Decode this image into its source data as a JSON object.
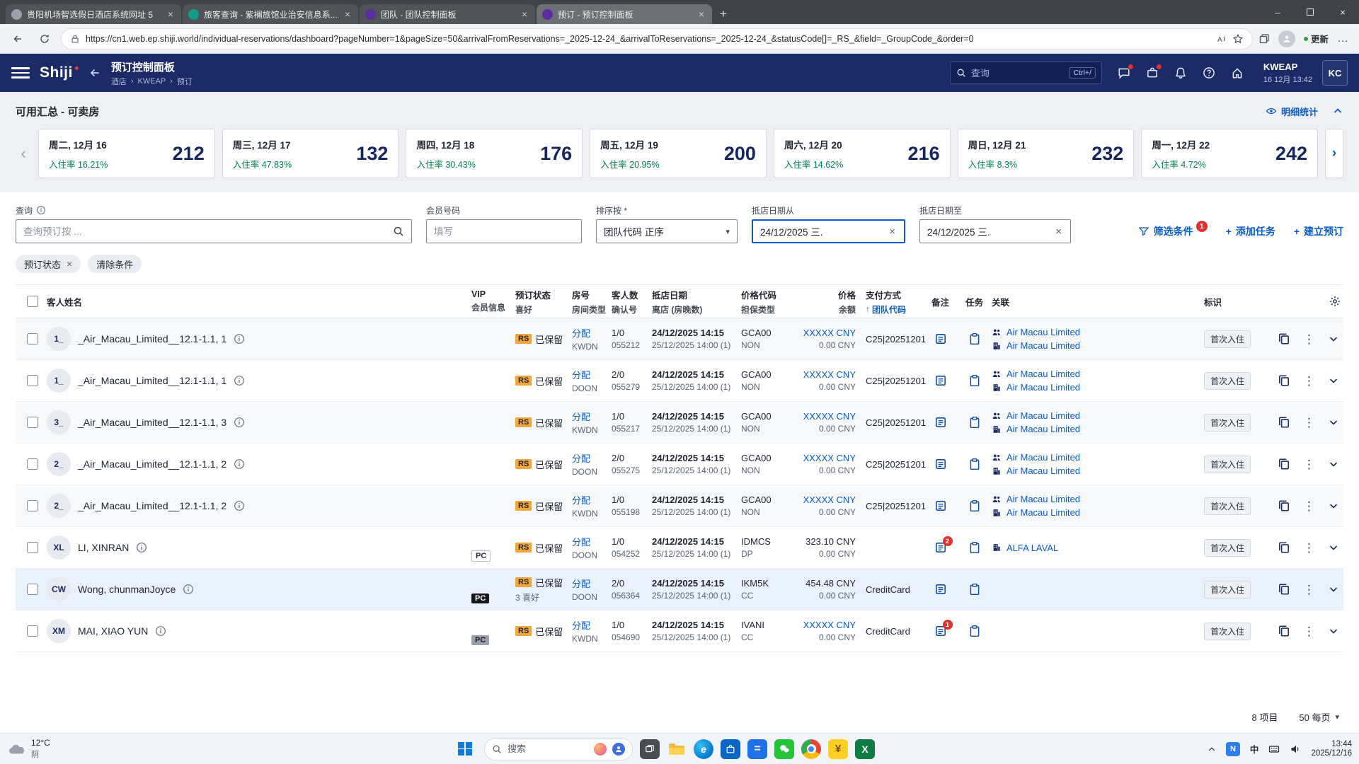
{
  "icons": {
    "close": "×",
    "plus": "+",
    "kebab": "⋮",
    "arrow_left": "‹",
    "arrow_right": "›",
    "sort_up": "↑",
    "caret_down": "▾",
    "ellipsis": "…",
    "breadcrumb_sep": "›",
    "minimize": "–"
  },
  "browser": {
    "tabs": [
      {
        "title": "贵阳机场智选假日酒店系统网址 5",
        "fav": "fav-gray",
        "cls": ""
      },
      {
        "title": "旅客查询 - 紫襕旅馆业治安信息系...",
        "fav": "fav-teal",
        "cls": ""
      },
      {
        "title": "团队 - 团队控制面板",
        "fav": "fav-purple",
        "cls": ""
      },
      {
        "title": "预订 - 预订控制面板",
        "fav": "fav-purple",
        "cls": "active"
      }
    ],
    "url": "https://cn1.web.ep.shiji.world/individual-reservations/dashboard?pageNumber=1&pageSize=50&arrivalFromReservations=_2025-12-24_&arrivalToReservations=_2025-12-24_&statusCode[]=_RS_&field=_GroupCode_&order=0",
    "update_label": "更新"
  },
  "app_header": {
    "logo": "Shiji",
    "title": "预订控制面板",
    "breadcrumb": {
      "hotel": "酒店",
      "property": "KWEAP",
      "page": "预订"
    },
    "search_placeholder": "查询",
    "search_shortcut": "Ctrl+/",
    "property": "KWEAP",
    "datetime": "16 12月 13:42",
    "avatar": "KC"
  },
  "availability": {
    "title": "可用汇总 - 可卖房",
    "detail_link": "明细统计",
    "days": [
      {
        "date": "周二, 12月 16",
        "occ": "入住率 16.21%",
        "count": "212"
      },
      {
        "date": "周三, 12月 17",
        "occ": "入住率 47.83%",
        "count": "132"
      },
      {
        "date": "周四, 12月 18",
        "occ": "入住率 30.43%",
        "count": "176"
      },
      {
        "date": "周五, 12月 19",
        "occ": "入住率 20.95%",
        "count": "200"
      },
      {
        "date": "周六, 12月 20",
        "occ": "入住率 14.62%",
        "count": "216"
      },
      {
        "date": "周日, 12月 21",
        "occ": "入住率 8.3%",
        "count": "232"
      },
      {
        "date": "周一, 12月 22",
        "occ": "入住率 4.72%",
        "count": "242"
      }
    ]
  },
  "filters": {
    "query_label": "查询",
    "query_placeholder": "查询预订按 ...",
    "member_label": "会员号码",
    "member_placeholder": "填写",
    "sort_label": "排序按 *",
    "sort_value": "团队代码 正序",
    "arrival_from_label": "抵店日期从",
    "arrival_from_value": "24/12/2025 三.",
    "arrival_to_label": "抵店日期至",
    "arrival_to_value": "24/12/2025 三.",
    "filter_button": "筛选条件",
    "filter_badge": "1",
    "add_task_button": "添加任务",
    "create_reservation_button": "建立预订",
    "chip_status": "预订状态",
    "chip_clear": "清除条件"
  },
  "table": {
    "headers": {
      "guest": "客人姓名",
      "vip1": "VIP",
      "vip2": "会员信息",
      "status1": "预订状态",
      "status2": "喜好",
      "room1": "房号",
      "room2": "房间类型",
      "guests1": "客人数",
      "guests2": "确认号",
      "dates1": "抵店日期",
      "dates2": "离店 (房晚数)",
      "rate1": "价格代码",
      "rate2": "担保类型",
      "price1": "价格",
      "price2": "余额",
      "pay1": "支付方式",
      "pay2": "团队代码",
      "notes": "备注",
      "tasks": "任务",
      "links": "关联",
      "tags": "标识"
    },
    "rows": [
      {
        "initials": "1_",
        "name": "_Air_Macau_Limited__12.1-1.1, 1",
        "vip": "",
        "vip_cls": "",
        "status_code": "RS",
        "status": "已保留",
        "prefs": "",
        "room_action": "分配",
        "room_type": "KWDN",
        "guests": "1/0",
        "confirmation": "055212",
        "arrival": "24/12/2025 14:15",
        "departure": "25/12/2025 14:00 (1)",
        "rate_code": "GCA00",
        "guarantee": "NON",
        "price": "XXXXX CNY",
        "price_cls": "masked",
        "balance": "0.00 CNY",
        "payment": "C25|20251201",
        "note_badge": "",
        "link1": "Air Macau Limited",
        "link1_agent": true,
        "link1_company": false,
        "link2": "Air Macau Limited",
        "tag": "首次入住",
        "row_cls": ""
      },
      {
        "initials": "1_",
        "name": "_Air_Macau_Limited__12.1-1.1, 1",
        "vip": "",
        "vip_cls": "",
        "status_code": "RS",
        "status": "已保留",
        "prefs": "",
        "room_action": "分配",
        "room_type": "DOON",
        "guests": "2/0",
        "confirmation": "055279",
        "arrival": "24/12/2025 14:15",
        "departure": "25/12/2025 14:00 (1)",
        "rate_code": "GCA00",
        "guarantee": "NON",
        "price": "XXXXX CNY",
        "price_cls": "masked",
        "balance": "0.00 CNY",
        "payment": "C25|20251201",
        "note_badge": "",
        "link1": "Air Macau Limited",
        "link1_agent": true,
        "link1_company": false,
        "link2": "Air Macau Limited",
        "tag": "首次入住",
        "row_cls": ""
      },
      {
        "initials": "3_",
        "name": "_Air_Macau_Limited__12.1-1.1, 3",
        "vip": "",
        "vip_cls": "",
        "status_code": "RS",
        "status": "已保留",
        "prefs": "",
        "room_action": "分配",
        "room_type": "KWDN",
        "guests": "1/0",
        "confirmation": "055217",
        "arrival": "24/12/2025 14:15",
        "departure": "25/12/2025 14:00 (1)",
        "rate_code": "GCA00",
        "guarantee": "NON",
        "price": "XXXXX CNY",
        "price_cls": "masked",
        "balance": "0.00 CNY",
        "payment": "C25|20251201",
        "note_badge": "",
        "link1": "Air Macau Limited",
        "link1_agent": true,
        "link1_company": false,
        "link2": "Air Macau Limited",
        "tag": "首次入住",
        "row_cls": ""
      },
      {
        "initials": "2_",
        "name": "_Air_Macau_Limited__12.1-1.1, 2",
        "vip": "",
        "vip_cls": "",
        "status_code": "RS",
        "status": "已保留",
        "prefs": "",
        "room_action": "分配",
        "room_type": "DOON",
        "guests": "2/0",
        "confirmation": "055275",
        "arrival": "24/12/2025 14:15",
        "departure": "25/12/2025 14:00 (1)",
        "rate_code": "GCA00",
        "guarantee": "NON",
        "price": "XXXXX CNY",
        "price_cls": "masked",
        "balance": "0.00 CNY",
        "payment": "C25|20251201",
        "note_badge": "",
        "link1": "Air Macau Limited",
        "link1_agent": true,
        "link1_company": false,
        "link2": "Air Macau Limited",
        "tag": "首次入住",
        "row_cls": ""
      },
      {
        "initials": "2_",
        "name": "_Air_Macau_Limited__12.1-1.1, 2",
        "vip": "",
        "vip_cls": "",
        "status_code": "RS",
        "status": "已保留",
        "prefs": "",
        "room_action": "分配",
        "room_type": "KWDN",
        "guests": "1/0",
        "confirmation": "055198",
        "arrival": "24/12/2025 14:15",
        "departure": "25/12/2025 14:00 (1)",
        "rate_code": "GCA00",
        "guarantee": "NON",
        "price": "XXXXX CNY",
        "price_cls": "masked",
        "balance": "0.00 CNY",
        "payment": "C25|20251201",
        "note_badge": "",
        "link1": "Air Macau Limited",
        "link1_agent": true,
        "link1_company": false,
        "link2": "Air Macau Limited",
        "tag": "首次入住",
        "row_cls": ""
      },
      {
        "initials": "XL",
        "name": "LI, XINRAN",
        "vip": "PC",
        "vip_cls": "pc-outline",
        "status_code": "RS",
        "status": "已保留",
        "prefs": "",
        "room_action": "分配",
        "room_type": "DOON",
        "guests": "1/0",
        "confirmation": "054252",
        "arrival": "24/12/2025 14:15",
        "departure": "25/12/2025 14:00 (1)",
        "rate_code": "IDMCS",
        "guarantee": "DP",
        "price": "323.10 CNY",
        "price_cls": "",
        "balance": "0.00 CNY",
        "payment": "",
        "note_badge": "2",
        "link1": "ALFA LAVAL",
        "link1_agent": false,
        "link1_company": true,
        "link2": "",
        "tag": "首次入住",
        "row_cls": ""
      },
      {
        "initials": "CW",
        "name": "Wong, chunmanJoyce",
        "vip": "PC",
        "vip_cls": "pc-black",
        "status_code": "RS",
        "status": "已保留",
        "prefs": "3 喜好",
        "room_action": "分配",
        "room_type": "DOON",
        "guests": "2/0",
        "confirmation": "056364",
        "arrival": "24/12/2025 14:15",
        "departure": "25/12/2025 14:00 (1)",
        "rate_code": "IKM5K",
        "guarantee": "CC",
        "price": "454.48 CNY",
        "price_cls": "",
        "balance": "0.00 CNY",
        "payment": "CreditCard",
        "note_badge": "",
        "link1": "",
        "link1_agent": false,
        "link1_company": false,
        "link2": "",
        "tag": "首次入住",
        "row_cls": "highlight"
      },
      {
        "initials": "XM",
        "name": "MAI, XIAO YUN",
        "vip": "PC",
        "vip_cls": "pc-gray",
        "status_code": "RS",
        "status": "已保留",
        "prefs": "",
        "room_action": "分配",
        "room_type": "KWDN",
        "guests": "1/0",
        "confirmation": "054690",
        "arrival": "24/12/2025 14:15",
        "departure": "25/12/2025 14:00 (1)",
        "rate_code": "IVANI",
        "guarantee": "CC",
        "price": "XXXXX CNY",
        "price_cls": "masked",
        "balance": "0.00 CNY",
        "payment": "CreditCard",
        "note_badge": "1",
        "link1": "",
        "link1_agent": false,
        "link1_company": false,
        "link2": "",
        "tag": "首次入住",
        "row_cls": ""
      }
    ],
    "footer": {
      "items": "8 项目",
      "per_page": "50 每页"
    }
  },
  "taskbar": {
    "weather_temp": "12°C",
    "weather_desc": "阴",
    "search_placeholder": "搜索",
    "icon_names": [
      "task-view",
      "file-explorer",
      "edge",
      "store",
      "calculator",
      "wechat",
      "chrome",
      "pay-app",
      "excel"
    ],
    "lang": "中",
    "time": "13:44",
    "date": "2025/12/16"
  }
}
